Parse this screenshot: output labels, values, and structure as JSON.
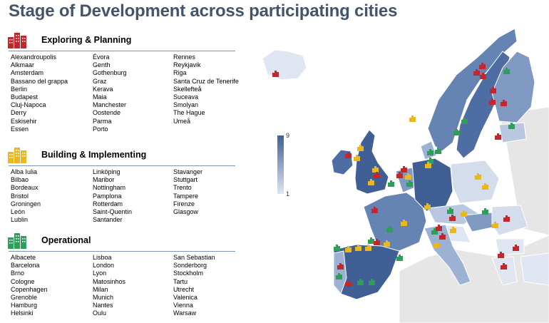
{
  "title": "Stage of Development across participating cities",
  "colors": {
    "title": "#44546a",
    "exploring": "#c0282e",
    "building": "#e8b820",
    "operational": "#2e9e5b",
    "map_high": "#3f5f95",
    "map_low": "#dfe6f2",
    "sea": "#ffffff",
    "non_participating": "#e4e4e4"
  },
  "legend": {
    "max": "9",
    "min": "1"
  },
  "sections": [
    {
      "title": "Exploring & Planning",
      "icon": "red-buildings-icon",
      "columns": [
        [
          "Alexandroupolis",
          "Alkmaar",
          "Amsterdam",
          "Bassano del grappa",
          "Berlin",
          "Budapest",
          "Cluj-Napoca",
          "Derry",
          "Eskisehir",
          "Essen"
        ],
        [
          "Évora",
          "Genth",
          "Gothenburg",
          "Graz",
          "Kerava",
          "Maia",
          "Manchester",
          "Oostende",
          "Parma",
          "Porto"
        ],
        [
          "Rennes",
          "Reykjavik",
          "Riga",
          "Santa Cruz de Tenerife",
          "Skellefteå",
          "Suceava",
          "Smolyan",
          "The Hague",
          "Umeå"
        ]
      ]
    },
    {
      "title": "Building & Implementing",
      "icon": "yellow-buildings-icon",
      "columns": [
        [
          "Alba Iulia",
          "Bilbao",
          "Bordeaux",
          "Bristol",
          "Groningen",
          "León",
          "Lublin"
        ],
        [
          "Linköping",
          "Maribor",
          "Nottingham",
          "Pamplona",
          "Rotterdam",
          "Saint-Quentin",
          "Santander"
        ],
        [
          "Stavanger",
          "Stuttgart",
          "Trento",
          "Tampere",
          "Firenze",
          "Glasgow"
        ]
      ]
    },
    {
      "title": "Operational",
      "icon": "green-buildings-icon",
      "columns": [
        [
          "Albacete",
          "Barcelona",
          "Brno",
          "Cologne",
          "Copenhagen",
          "Grenoble",
          "Hamburg",
          "Helsinki"
        ],
        [
          "Lisboa",
          "London",
          "Lyon",
          "Matosinhos",
          "Milan",
          "Munich",
          "Nantes",
          "Oulu"
        ],
        [
          "San Sebastian",
          "Sonderborg",
          "Stockholm",
          "Tartu",
          "Utrecht",
          "Valenica",
          "Vienna",
          "Warsaw"
        ]
      ]
    }
  ]
}
